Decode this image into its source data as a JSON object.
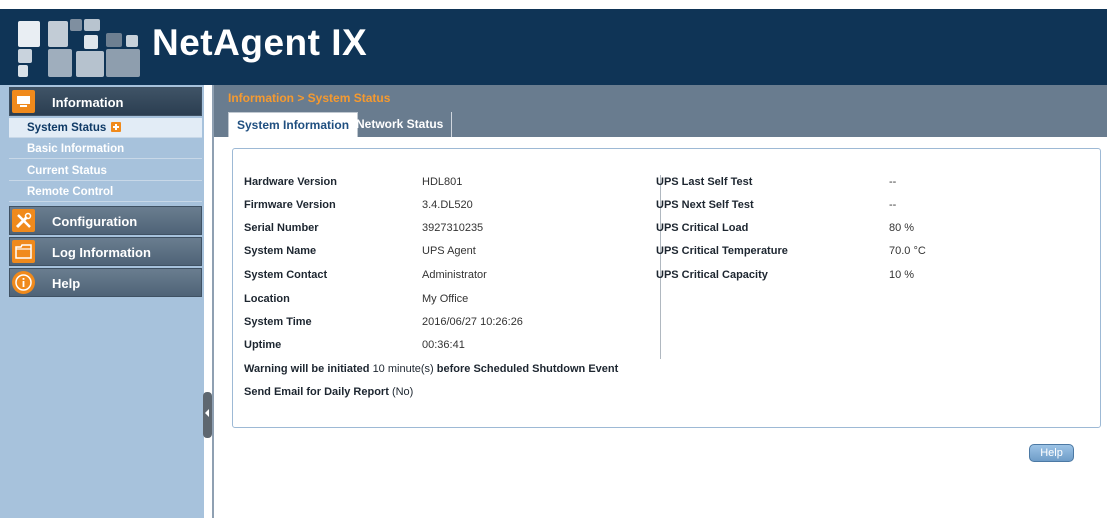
{
  "header": {
    "brand": "NetAgent IX"
  },
  "sidebar": {
    "sections": [
      {
        "label": "Information",
        "icon": "monitor-icon"
      },
      {
        "label": "Configuration",
        "icon": "tools-icon"
      },
      {
        "label": "Log Information",
        "icon": "folder-icon"
      },
      {
        "label": "Help",
        "icon": "info-icon"
      }
    ],
    "info_items": [
      {
        "label": "System Status"
      },
      {
        "label": "Basic Information"
      },
      {
        "label": "Current Status"
      },
      {
        "label": "Remote Control"
      }
    ]
  },
  "main": {
    "breadcrumb": "Information > System Status",
    "tabs": [
      {
        "label": "System Information"
      },
      {
        "label": "Network Status"
      }
    ],
    "left_rows": [
      {
        "label": "Hardware Version",
        "value": "HDL801"
      },
      {
        "label": "Firmware Version",
        "value": "3.4.DL520"
      },
      {
        "label": "Serial Number",
        "value": "3927310235"
      },
      {
        "label": "System Name",
        "value": "UPS Agent"
      },
      {
        "label": "System Contact",
        "value": "Administrator"
      },
      {
        "label": "Location",
        "value": "My Office"
      },
      {
        "label": "System Time",
        "value": "2016/06/27 10:26:26"
      },
      {
        "label": "Uptime",
        "value": "00:36:41"
      }
    ],
    "right_rows": [
      {
        "label": "UPS Last Self Test",
        "value": "--"
      },
      {
        "label": "UPS Next Self Test",
        "value": "--"
      },
      {
        "label": "UPS Critical Load",
        "value": "80 %"
      },
      {
        "label": "UPS Critical Temperature",
        "value": "70.0 °C"
      },
      {
        "label": "UPS Critical Capacity",
        "value": "10 %"
      }
    ],
    "warning": {
      "prefix": "Warning will be initiated",
      "value": "10 minute(s)",
      "suffix": "before Scheduled Shutdown Event"
    },
    "email": {
      "label": "Send Email for Daily Report",
      "value": "(No)"
    },
    "help_button": "Help"
  },
  "colors": {
    "header_bg": "#0f3456",
    "sidebar_bg": "#a7c2dc",
    "accent_orange": "#f08a1c",
    "breadcrumb": "#f59a30"
  }
}
